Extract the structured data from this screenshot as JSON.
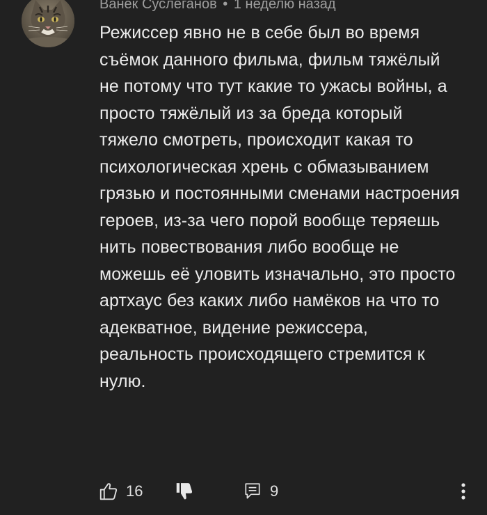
{
  "comment": {
    "author": "Ванек Суслеганов",
    "separator": "•",
    "time": "1 неделю назад",
    "text": "Режиссер явно не в себе был во время съёмок данного фильма, фильм тяжёлый не потому что тут какие то ужасы войны, а просто тяжёлый из за бреда который тяжело смотреть, происходит какая то психологическая хрень с обмазыванием грязью и постоянными сменами настроения героев, из-за чего порой вообще теряешь нить повествования либо вообще не можешь её уловить изначально, это просто артхаус без каких либо намёков на что то адекватное, видение режиссера, реальность происходящего стремится к нулю.",
    "likes": "16",
    "replies": "9"
  },
  "icons": {
    "like": "thumb-up-icon",
    "dislike": "thumb-down-icon",
    "reply": "reply-icon",
    "more": "more-vertical-icon"
  },
  "colors": {
    "background": "#212121",
    "text": "#ebebeb",
    "meta": "#9e9e9e"
  }
}
